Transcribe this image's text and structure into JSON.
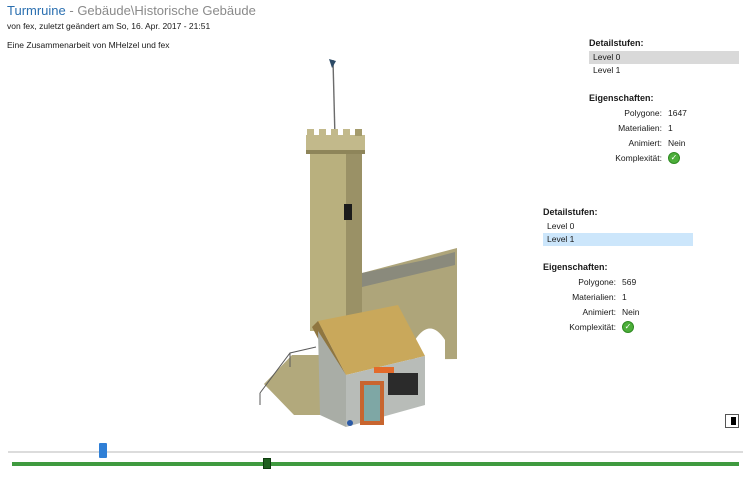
{
  "header": {
    "name": "Turmruine",
    "path": " - Gebäude\\Historische Gebäude",
    "byline": "von fex, zuletzt geändert am So, 16. Apr. 2017 - 21:51",
    "collab": "Eine Zusammenarbeit von MHelzel und fex"
  },
  "panels": [
    {
      "heading": "Detailstufen:",
      "levels": [
        "Level 0",
        "Level 1"
      ],
      "props_heading": "Eigenschaften:",
      "props": [
        {
          "k": "Polygone:",
          "v": "1647"
        },
        {
          "k": "Materialien:",
          "v": "1"
        },
        {
          "k": "Animiert:",
          "v": "Nein"
        },
        {
          "k": "Komplexität:",
          "v": ""
        }
      ]
    },
    {
      "heading": "Detailstufen:",
      "levels": [
        "Level 0",
        "Level 1"
      ],
      "props_heading": "Eigenschaften:",
      "props": [
        {
          "k": "Polygone:",
          "v": "569"
        },
        {
          "k": "Materialien:",
          "v": "1"
        },
        {
          "k": "Animiert:",
          "v": "Nein"
        },
        {
          "k": "Komplexität:",
          "v": ""
        }
      ]
    }
  ],
  "icons": {
    "complexity": "check-circle-icon",
    "toggle": "half-square-icon"
  },
  "sliders": {
    "view_position": 0.13,
    "time_position": 0.35
  },
  "colors": {
    "accent": "#2a6fb0",
    "ok": "#4cae3a",
    "track": "#3f9a3f"
  }
}
